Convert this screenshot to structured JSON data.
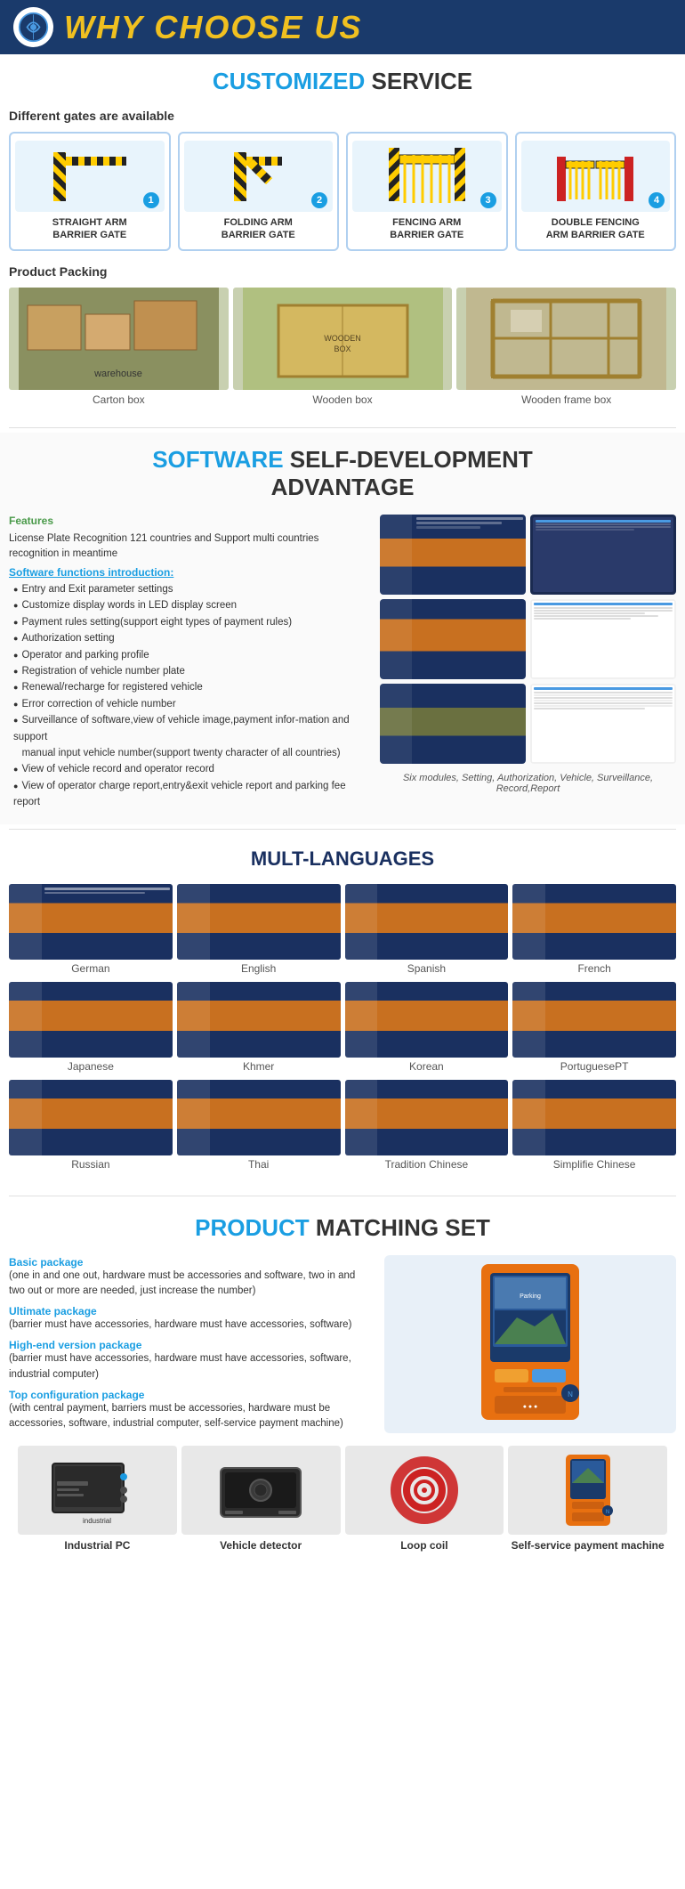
{
  "header": {
    "title_part1": "WHY CHOOSE ",
    "title_part2": "US"
  },
  "customized": {
    "section_title_highlight": "CUSTOMIZED",
    "section_title_normal": " SERVICE",
    "subtitle": "Different gates are available",
    "gates": [
      {
        "num": "1",
        "label": "STRAIGHT ARM\nBARRIER GATE"
      },
      {
        "num": "2",
        "label": "FOLDING ARM\nBARRIER GATE"
      },
      {
        "num": "3",
        "label": "FENCING ARM\nBARRIER GATE"
      },
      {
        "num": "4",
        "label": "DOUBLE FENCING\nARM BARRIER GATE"
      }
    ],
    "packing_title": "Product Packing",
    "packing_items": [
      {
        "label": "Carton box"
      },
      {
        "label": "Wooden box"
      },
      {
        "label": "Wooden frame box"
      }
    ]
  },
  "software": {
    "section_title_highlight": "SOFTWARE",
    "section_title_normal": " SELF-DEVELOPMENT\nADVANTAGE",
    "features_label": "Features",
    "features_text": "License Plate Recognition 121 countries and Support multi countries recognition in meantime",
    "intro_label": "Software functions introduction:",
    "bullets": [
      "Entry and Exit parameter settings",
      "Customize display words in LED display screen",
      "Payment rules setting(support eight types of  payment rules)",
      "Authorization setting",
      "Operator and parking profile",
      "Registration of vehicle number plate",
      "Renewal/recharge for registered vehicle",
      "Error correction of vehicle number",
      "Surveillance of software,view of vehicle image,payment information and support\n   manual input vehicle number(support twenty character of all countries)",
      "View of vehicle record and operator record",
      "View of operator charge report,entry&exit vehicle report and parking fee report"
    ],
    "caption": "Six modules, Setting, Authorization, Vehicle,\nSurveillance, Record,Report"
  },
  "languages": {
    "section_title": "MULT-LANGUAGES",
    "items": [
      "German",
      "English",
      "Spanish",
      "French",
      "Japanese",
      "Khmer",
      "Korean",
      "PortuguesePT",
      "Russian",
      "Thai",
      "Tradition Chinese",
      "Simplifie Chinese"
    ]
  },
  "matching": {
    "section_title_highlight": "PRODUCT",
    "section_title_normal": " MATCHING SET",
    "packages": [
      {
        "title": "Basic package",
        "text": "(one in and one out, hardware must be accessories and software, two in and two out or more are needed, just increase the number)"
      },
      {
        "title": "Ultimate package",
        "text": "(barrier must have accessories, hardware must have accessories, software)"
      },
      {
        "title": "High-end version package",
        "text": "(barrier must have accessories, hardware must have accessories, software, industrial computer)"
      },
      {
        "title": "Top configuration package",
        "text": "(with central payment, barriers must be accessories, hardware must be accessories, software, industrial computer, self-service payment machine)"
      }
    ],
    "products": [
      {
        "label": "Industrial PC"
      },
      {
        "label": "Vehicle detector"
      },
      {
        "label": "Loop coil"
      },
      {
        "label": "Self-service payment machine"
      }
    ]
  }
}
